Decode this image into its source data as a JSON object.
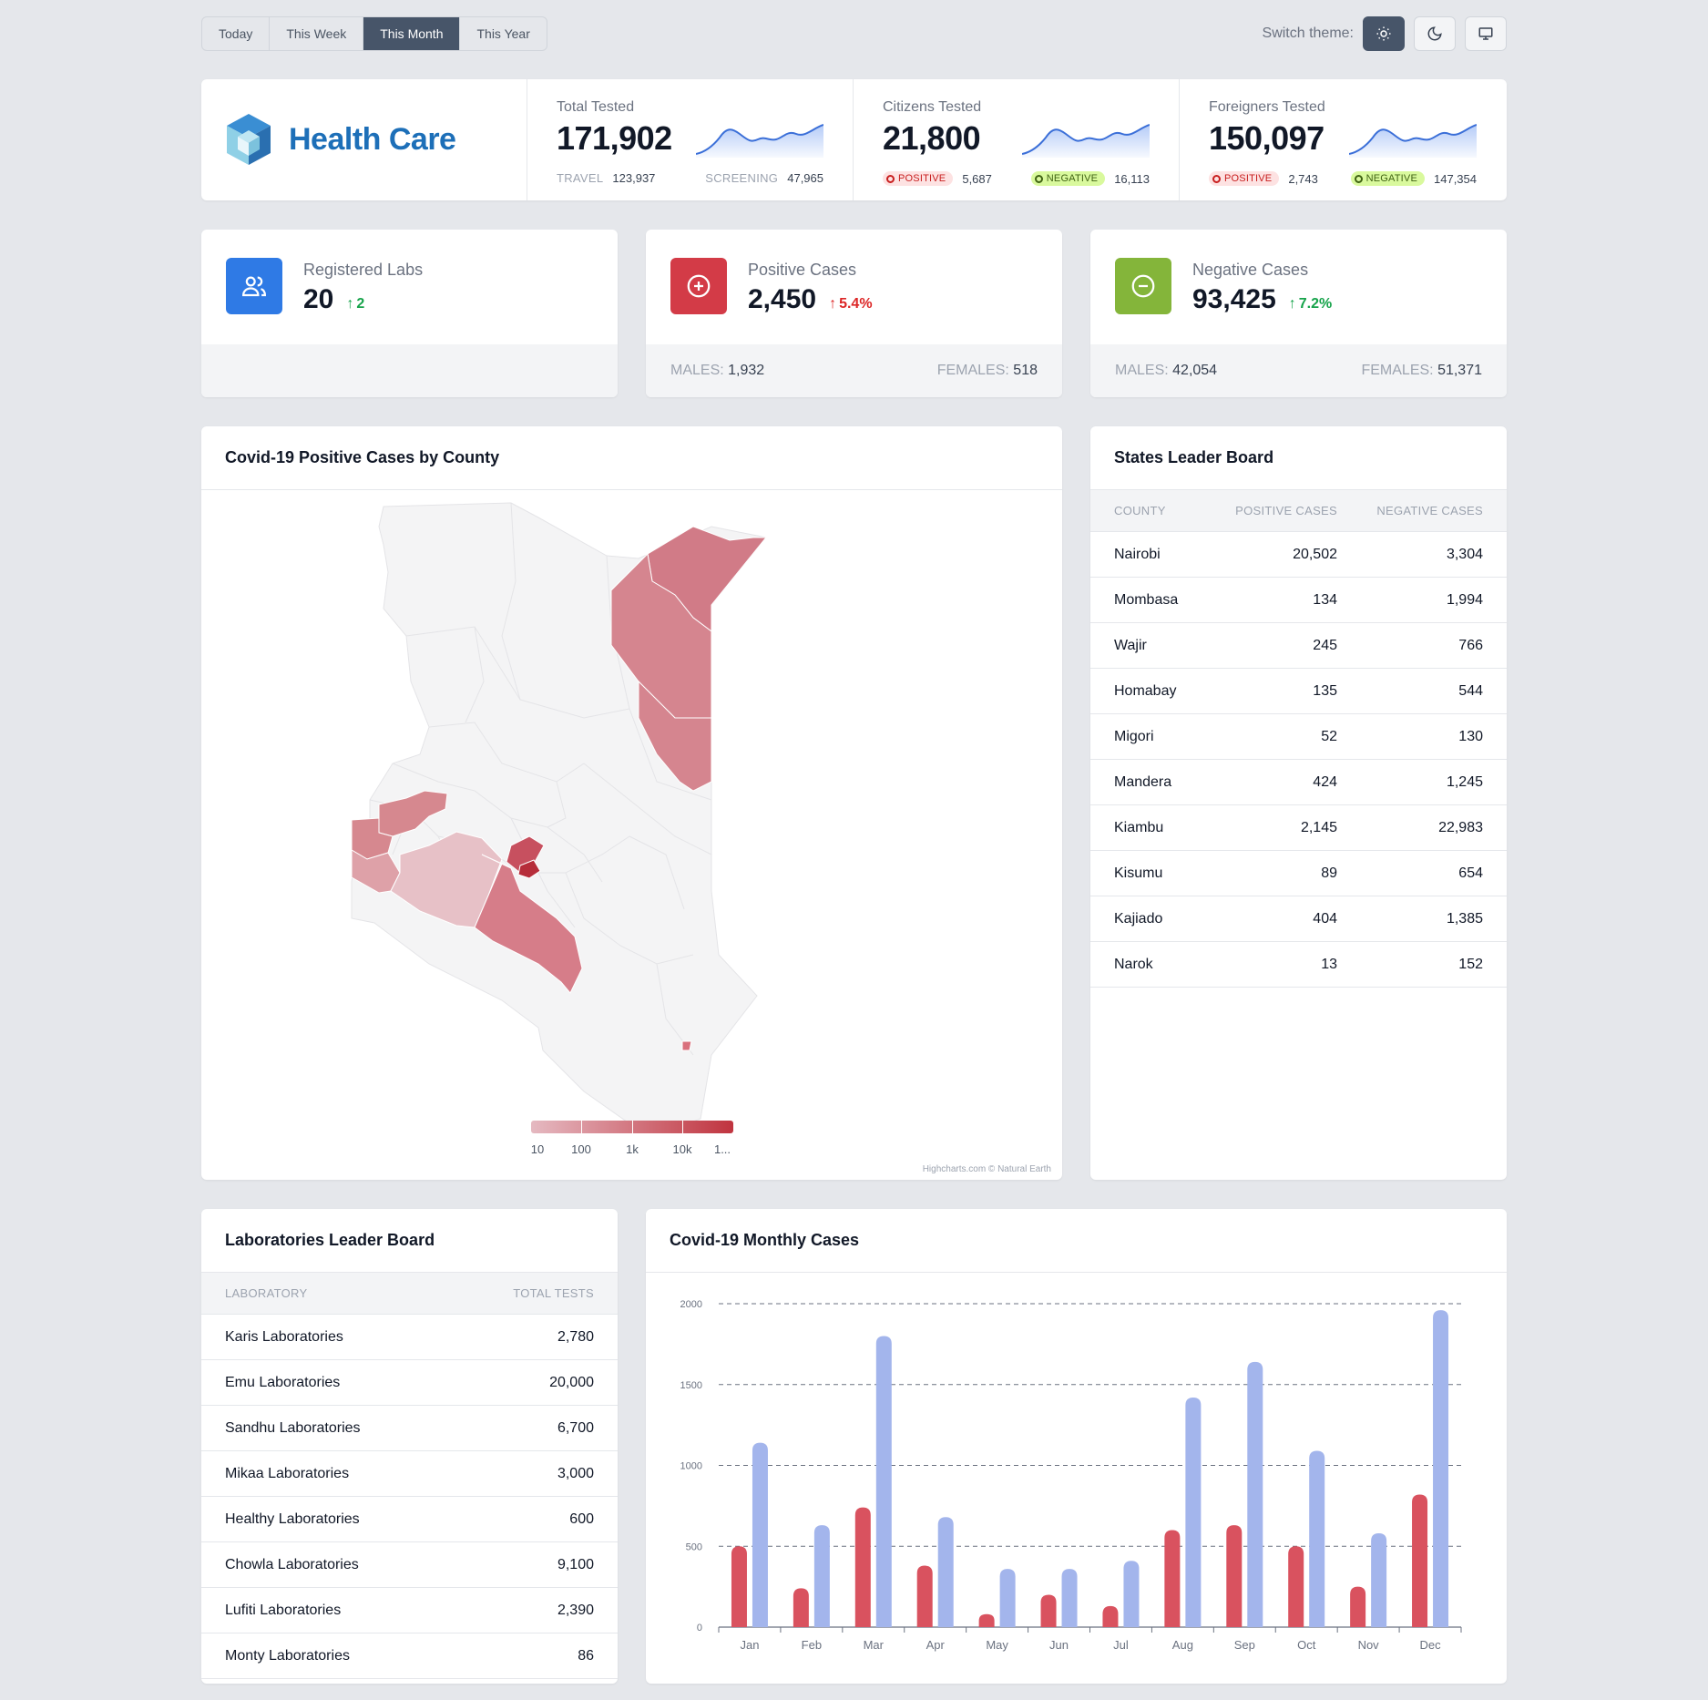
{
  "periods": [
    "Today",
    "This Week",
    "This Month",
    "This Year"
  ],
  "active_period": "This Month",
  "theme": {
    "label": "Switch theme:",
    "active": "light"
  },
  "brand": {
    "title": "Health Care",
    "logo": "cube-logo"
  },
  "stats": {
    "total": {
      "label": "Total Tested",
      "value": "171,902",
      "left_key": "TRAVEL",
      "left_val": "123,937",
      "right_key": "SCREENING",
      "right_val": "47,965"
    },
    "citizens": {
      "label": "Citizens Tested",
      "value": "21,800",
      "positive_label": "POSITIVE",
      "positive_val": "5,687",
      "negative_label": "NEGATIVE",
      "negative_val": "16,113"
    },
    "foreigners": {
      "label": "Foreigners Tested",
      "value": "150,097",
      "positive_label": "POSITIVE",
      "positive_val": "2,743",
      "negative_label": "NEGATIVE",
      "negative_val": "147,354"
    }
  },
  "summary": {
    "labs": {
      "label": "Registered Labs",
      "value": "20",
      "change": "2",
      "icon": "users-icon",
      "color": "#2f7ae5"
    },
    "positive": {
      "label": "Positive Cases",
      "value": "2,450",
      "change": "5.4%",
      "icon": "plus-circle-icon",
      "color": "#d33b47",
      "males_key": "MALES:",
      "males_val": "1,932",
      "females_key": "FEMALES:",
      "females_val": "518"
    },
    "negative": {
      "label": "Negative Cases",
      "value": "93,425",
      "change": "7.2%",
      "icon": "minus-circle-icon",
      "color": "#84b53a",
      "males_key": "MALES:",
      "males_val": "42,054",
      "females_key": "FEMALES:",
      "females_val": "51,371"
    }
  },
  "map": {
    "title": "Covid-19 Positive Cases by County",
    "legend": [
      "10",
      "100",
      "1k",
      "10k",
      "1..."
    ],
    "credits": "Highcharts.com © Natural Earth"
  },
  "states": {
    "title": "States Leader Board",
    "columns": [
      "COUNTY",
      "POSITIVE CASES",
      "NEGATIVE CASES"
    ],
    "rows": [
      [
        "Nairobi",
        "20,502",
        "3,304"
      ],
      [
        "Mombasa",
        "134",
        "1,994"
      ],
      [
        "Wajir",
        "245",
        "766"
      ],
      [
        "Homabay",
        "135",
        "544"
      ],
      [
        "Migori",
        "52",
        "130"
      ],
      [
        "Mandera",
        "424",
        "1,245"
      ],
      [
        "Kiambu",
        "2,145",
        "22,983"
      ],
      [
        "Kisumu",
        "89",
        "654"
      ],
      [
        "Kajiado",
        "404",
        "1,385"
      ],
      [
        "Narok",
        "13",
        "152"
      ]
    ]
  },
  "labs": {
    "title": "Laboratories Leader Board",
    "columns": [
      "LABORATORY",
      "TOTAL TESTS"
    ],
    "rows": [
      [
        "Karis Laboratories",
        "2,780"
      ],
      [
        "Emu Laboratories",
        "20,000"
      ],
      [
        "Sandhu Laboratories",
        "6,700"
      ],
      [
        "Mikaa Laboratories",
        "3,000"
      ],
      [
        "Healthy Laboratories",
        "600"
      ],
      [
        "Chowla Laboratories",
        "9,100"
      ],
      [
        "Lufiti Laboratories",
        "2,390"
      ],
      [
        "Monty Laboratories",
        "86"
      ]
    ]
  },
  "chart_data": {
    "type": "bar",
    "title": "Covid-19 Monthly Cases",
    "categories": [
      "Jan",
      "Feb",
      "Mar",
      "Apr",
      "May",
      "Jun",
      "Jul",
      "Aug",
      "Sep",
      "Oct",
      "Nov",
      "Dec"
    ],
    "series": [
      {
        "color": "#d9525f",
        "values": [
          500,
          240,
          740,
          380,
          80,
          200,
          130,
          600,
          630,
          500,
          250,
          820
        ]
      },
      {
        "color": "#a3b5ec",
        "values": [
          1140,
          630,
          1800,
          680,
          360,
          360,
          410,
          1420,
          1640,
          1090,
          580,
          1960
        ]
      }
    ],
    "yticks": [
      0,
      500,
      1000,
      1500,
      2000
    ],
    "ylim": [
      0,
      2000
    ],
    "grid": "dashed"
  }
}
